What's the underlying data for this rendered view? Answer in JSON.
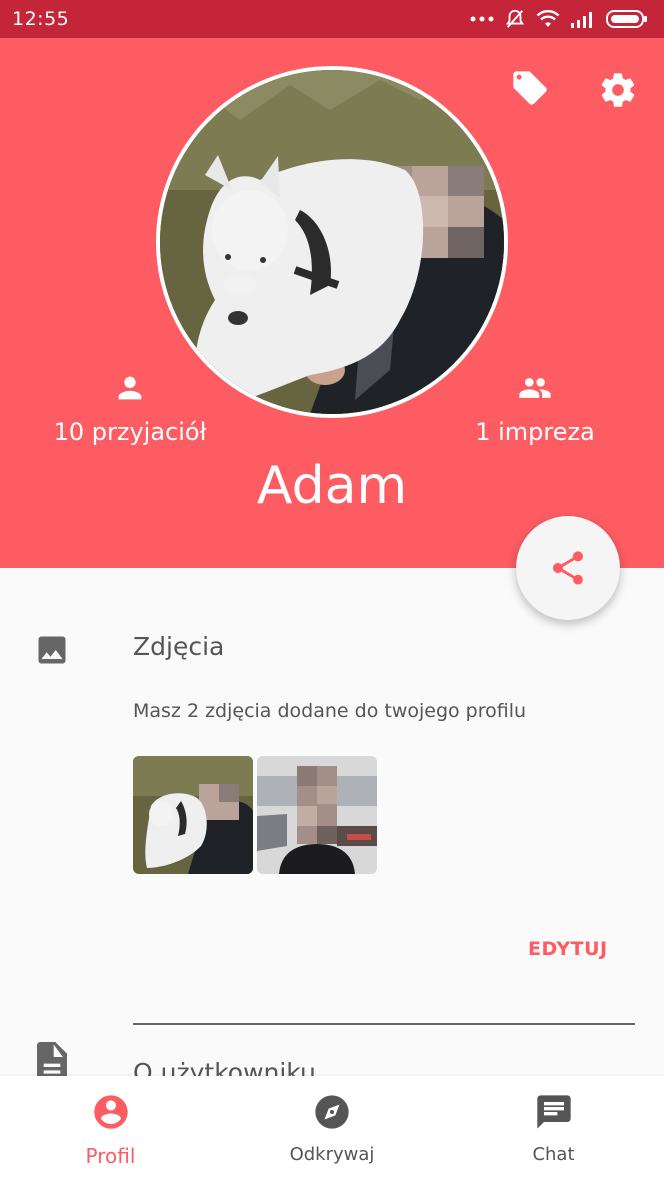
{
  "status_bar": {
    "time": "12:55",
    "dots": "..."
  },
  "header": {
    "friends_count_label": "10 przyjaciół",
    "parties_count_label": "1 impreza",
    "name": "Adam"
  },
  "photos_section": {
    "title": "Zdjęcia",
    "description": "Masz 2 zdjęcia dodane do twojego profilu",
    "edit_label": "EDYTUJ"
  },
  "about_section": {
    "title": "O użytkowniku"
  },
  "bottom_nav": {
    "items": [
      {
        "label": "Profil",
        "icon": "account-circle-icon",
        "active": true
      },
      {
        "label": "Odkrywaj",
        "icon": "compass-icon",
        "active": false
      },
      {
        "label": "Chat",
        "icon": "chat-icon",
        "active": false
      }
    ]
  },
  "colors": {
    "accent": "#fd5c63",
    "status_bar": "#c42538",
    "background": "#fafafa"
  }
}
